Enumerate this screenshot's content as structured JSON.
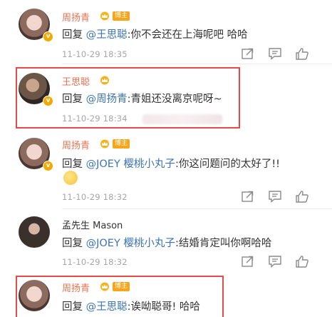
{
  "comments": [
    {
      "name": "周扬青",
      "vip_label": "博主",
      "reply_prefix": "回复",
      "mention": "@王思聪",
      "body": ":你不会还在上海呢吧 哈哈",
      "time": "11-10-29 18:35"
    },
    {
      "name": "王思聪",
      "reply_prefix": "回复",
      "mention": "@周扬青",
      "body": ":青姐还没离京呢呀~",
      "time": "11-10-29 18:34"
    },
    {
      "name": "周扬青",
      "vip_label": "博主",
      "reply_prefix": "回复",
      "mention": "@JOEY 樱桃小丸子",
      "body": ":你这问题问的太好了!!",
      "time": "11-10-29 18:32"
    },
    {
      "name": "孟先生 Mason",
      "reply_prefix": "回复",
      "mention": "@JOEY 樱桃小丸子",
      "body": ":结婚肯定叫你啊哈哈",
      "time": "11-10-29 18:32"
    },
    {
      "name": "周扬青",
      "vip_label": "博主",
      "reply_prefix": "回复",
      "mention": "@王思聪",
      "body": ":诶呦聪哥! 哈哈"
    }
  ],
  "icons": {
    "forward": "forward-icon",
    "comment": "comment-icon",
    "like": "like-icon"
  },
  "colors": {
    "highlight_border": "#e64b48",
    "username": "#eb7350",
    "mention": "#3c74b5",
    "timestamp": "#a6a6a6"
  }
}
